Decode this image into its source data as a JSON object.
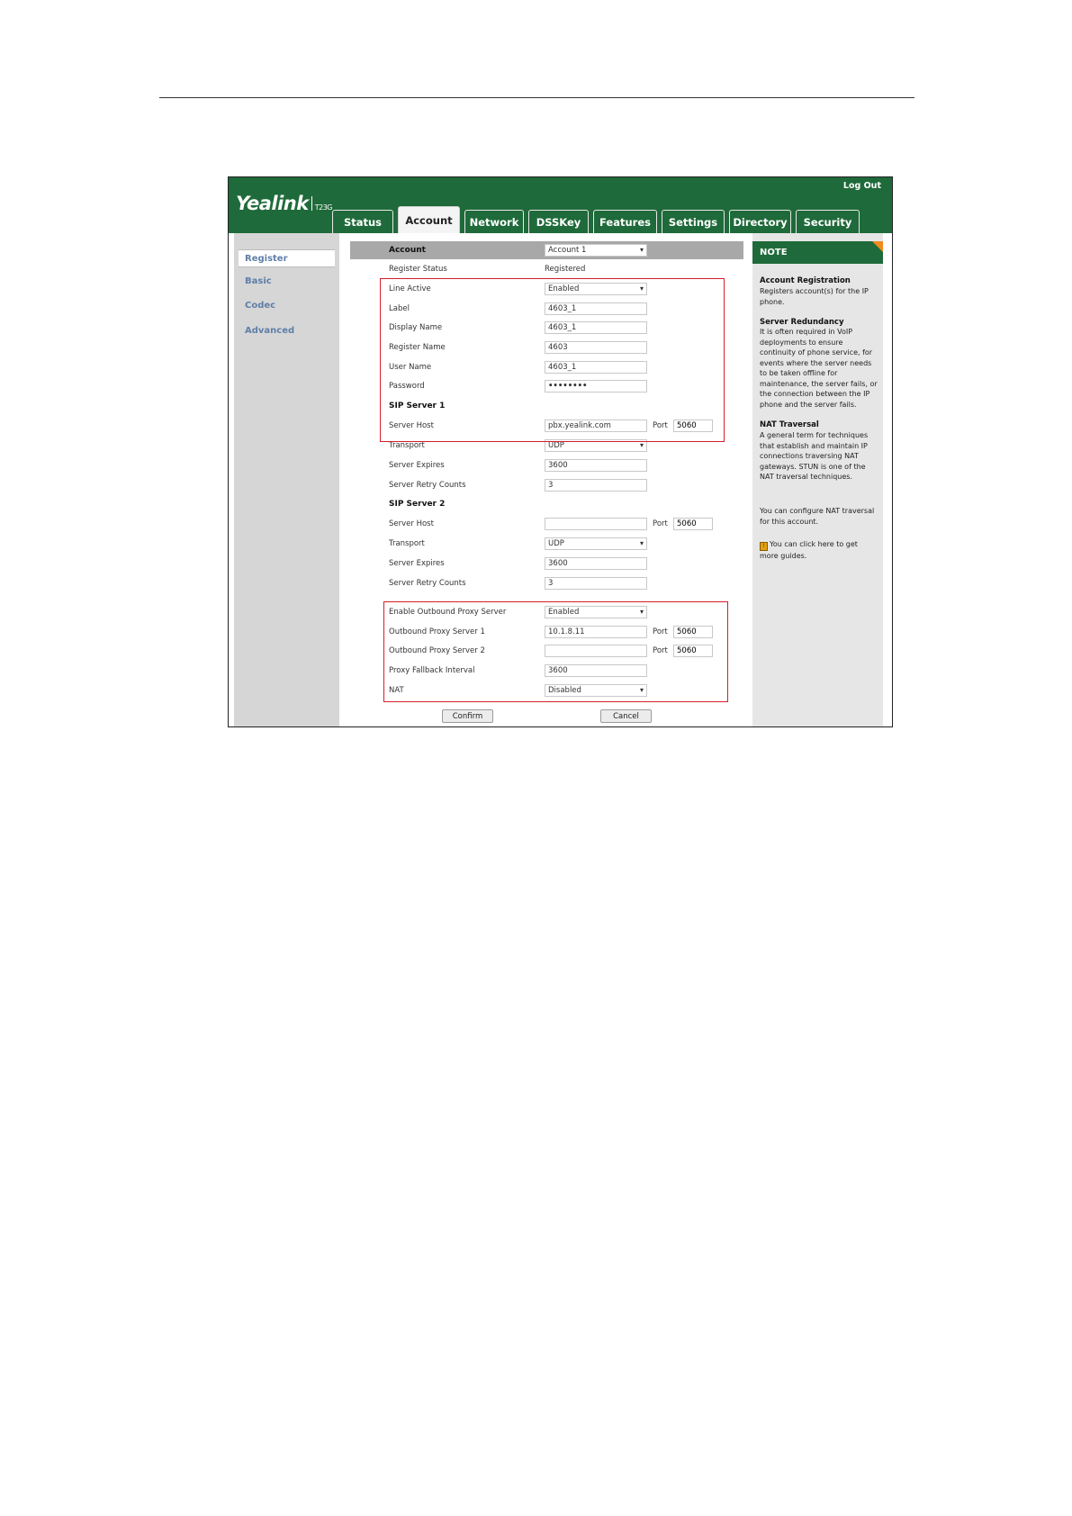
{
  "app": {
    "brand": "Yealink",
    "model": "T23G",
    "logout_label": "Log Out"
  },
  "tabs": [
    {
      "label": "Status"
    },
    {
      "label": "Account"
    },
    {
      "label": "Network"
    },
    {
      "label": "DSSKey"
    },
    {
      "label": "Features"
    },
    {
      "label": "Settings"
    },
    {
      "label": "Directory"
    },
    {
      "label": "Security"
    }
  ],
  "active_tab": "Account",
  "sidebar": {
    "items": [
      {
        "label": "Register"
      },
      {
        "label": "Basic"
      },
      {
        "label": "Codec"
      },
      {
        "label": "Advanced"
      }
    ]
  },
  "form": {
    "account": {
      "label": "Account",
      "value": "Account 1"
    },
    "register_status": {
      "label": "Register Status",
      "value": "Registered"
    },
    "line_active": {
      "label": "Line Active",
      "value": "Enabled"
    },
    "label": {
      "label": "Label",
      "value": "4603_1"
    },
    "display_name": {
      "label": "Display Name",
      "value": "4603_1"
    },
    "register_name": {
      "label": "Register Name",
      "value": "4603"
    },
    "user_name": {
      "label": "User Name",
      "value": "4603_1"
    },
    "password": {
      "label": "Password",
      "value": "••••••••"
    },
    "sip1": {
      "heading": "SIP Server 1",
      "server_host": {
        "label": "Server Host",
        "value": "pbx.yealink.com",
        "port_label": "Port",
        "port": "5060"
      },
      "transport": {
        "label": "Transport",
        "value": "UDP"
      },
      "server_expires": {
        "label": "Server Expires",
        "value": "3600"
      },
      "server_retry": {
        "label": "Server Retry Counts",
        "value": "3"
      }
    },
    "sip2": {
      "heading": "SIP Server 2",
      "server_host": {
        "label": "Server Host",
        "value": "",
        "port_label": "Port",
        "port": "5060"
      },
      "transport": {
        "label": "Transport",
        "value": "UDP"
      },
      "server_expires": {
        "label": "Server Expires",
        "value": "3600"
      },
      "server_retry": {
        "label": "Server Retry Counts",
        "value": "3"
      }
    },
    "outbound_enable": {
      "label": "Enable Outbound Proxy Server",
      "value": "Enabled"
    },
    "outbound1": {
      "label": "Outbound Proxy Server 1",
      "value": "10.1.8.11",
      "port_label": "Port",
      "port": "5060"
    },
    "outbound2": {
      "label": "Outbound Proxy Server 2",
      "value": "",
      "port_label": "Port",
      "port": "5060"
    },
    "fallback": {
      "label": "Proxy Fallback Interval",
      "value": "3600"
    },
    "nat": {
      "label": "NAT",
      "value": "Disabled"
    },
    "confirm_label": "Confirm",
    "cancel_label": "Cancel"
  },
  "note": {
    "header": "NOTE",
    "sections": [
      {
        "title": "Account Registration",
        "text": "Registers account(s) for the IP phone."
      },
      {
        "title": "Server Redundancy",
        "text": "It is often required in VoIP deployments to ensure continuity of phone service, for events where the server needs to be taken offline for maintenance, the server fails, or the connection between the IP phone and the server fails."
      },
      {
        "title": "NAT Traversal",
        "text": "A general term for techniques that establish and maintain IP connections traversing NAT gateways. STUN is one of the NAT traversal techniques."
      }
    ],
    "configure_text": "You can configure NAT traversal for this account.",
    "guide_text": "You can click here to get more guides."
  },
  "colors": {
    "header_green": "#1f6a3a",
    "highlight_red": "#d51f2a",
    "note_corner_orange": "#f08a1c",
    "sidebar_link": "#5f7fa8"
  }
}
